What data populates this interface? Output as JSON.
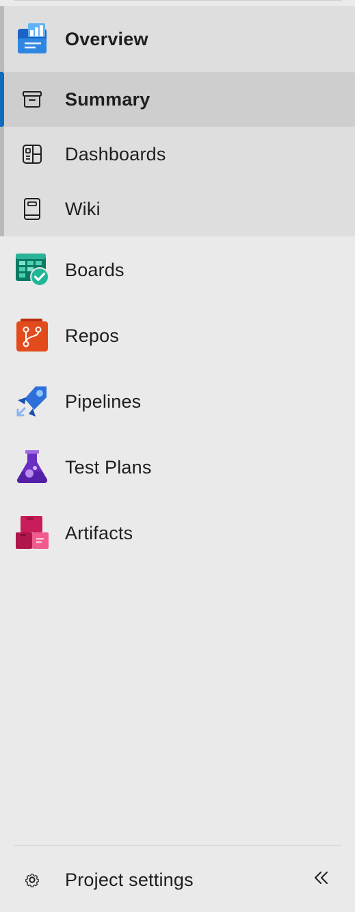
{
  "nav": {
    "overview": {
      "label": "Overview",
      "icon": "overview-icon"
    },
    "sub_items": [
      {
        "label": "Summary",
        "icon": "summary-icon",
        "selected": true
      },
      {
        "label": "Dashboards",
        "icon": "dashboards-icon"
      },
      {
        "label": "Wiki",
        "icon": "wiki-icon"
      }
    ],
    "services": [
      {
        "label": "Boards",
        "icon": "boards-icon"
      },
      {
        "label": "Repos",
        "icon": "repos-icon"
      },
      {
        "label": "Pipelines",
        "icon": "pipelines-icon"
      },
      {
        "label": "Test Plans",
        "icon": "test-plans-icon"
      },
      {
        "label": "Artifacts",
        "icon": "artifacts-icon"
      }
    ]
  },
  "footer": {
    "settings_label": "Project settings",
    "settings_icon": "gear-icon",
    "collapse_icon": "double-chevron-left-icon"
  },
  "colors": {
    "accent": "#0f6cbd",
    "sidebar_bg": "#eaeaea",
    "group_bg": "#dedede",
    "selected_bg": "#cecece"
  }
}
